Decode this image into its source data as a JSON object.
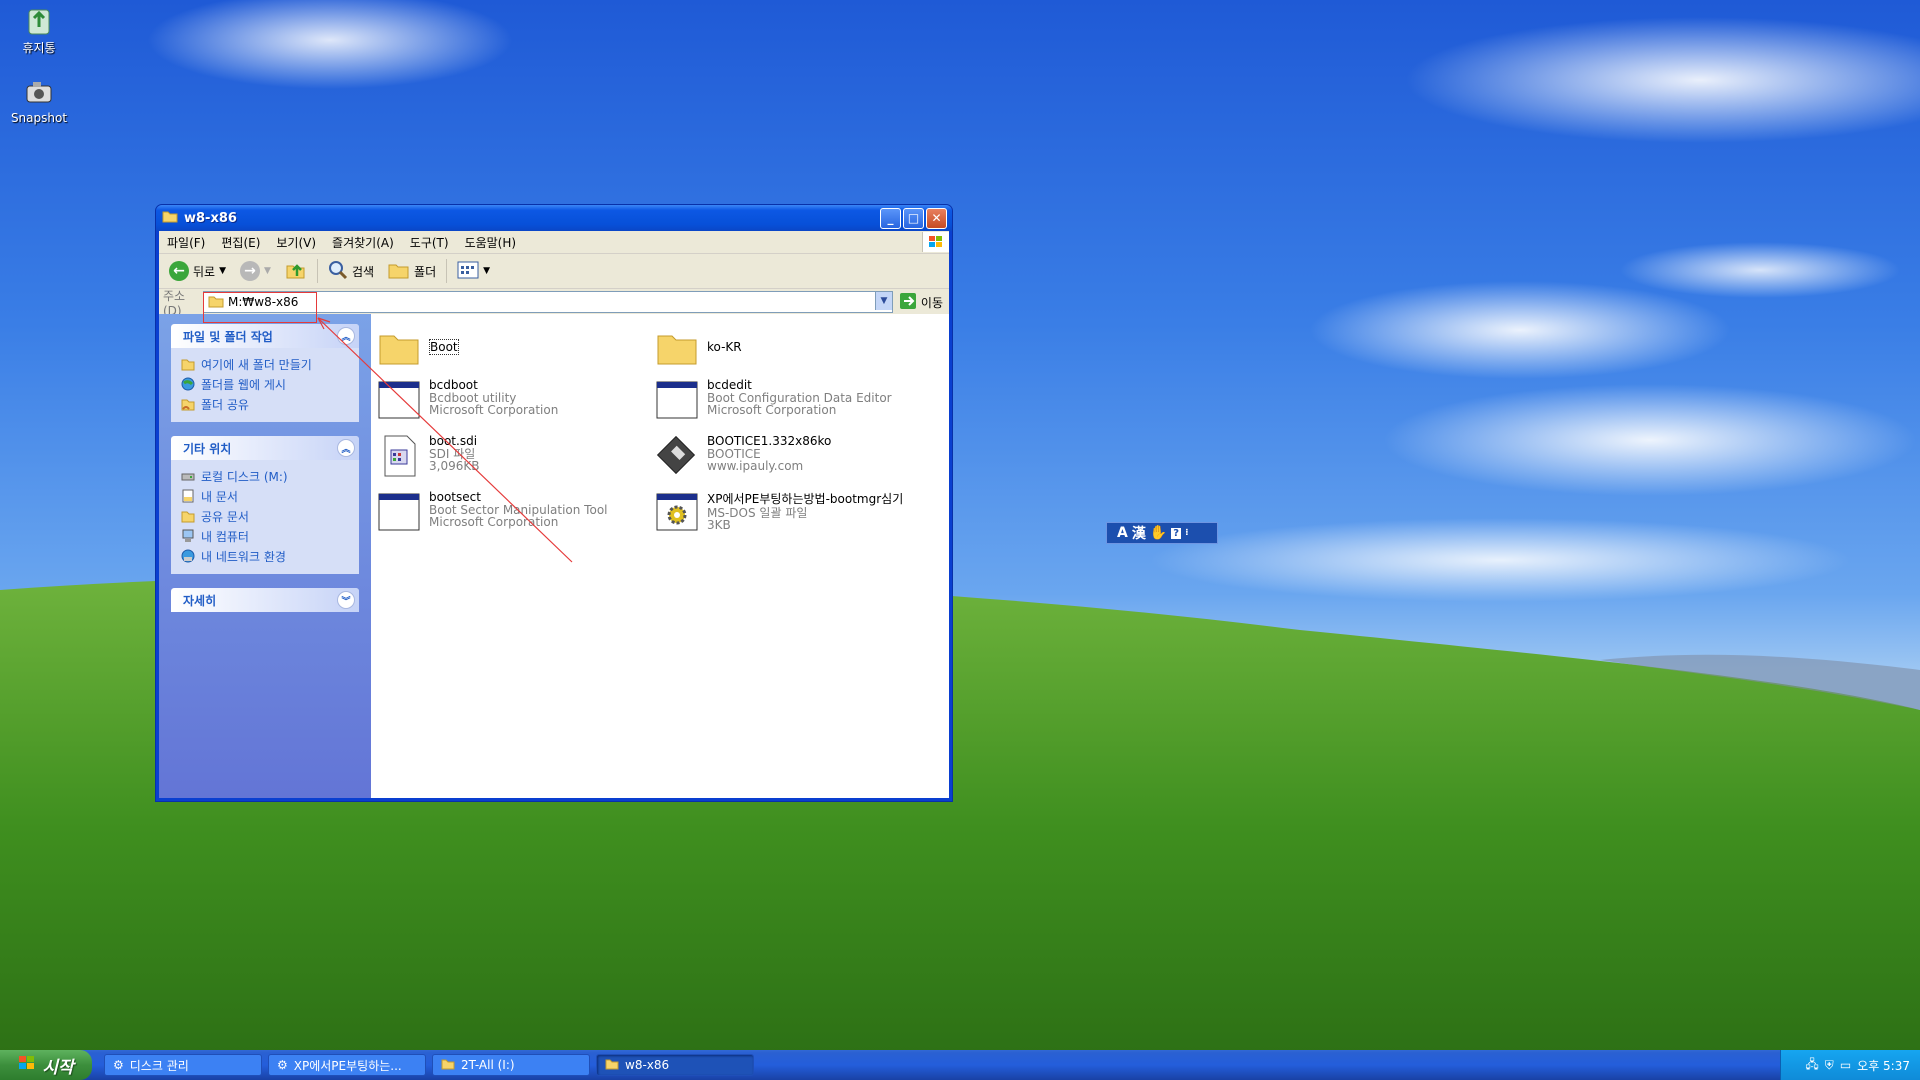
{
  "desktop": {
    "icons": [
      {
        "label": "휴지통",
        "icon": "recycle-bin-icon"
      },
      {
        "label": "Snapshot",
        "icon": "camera-icon"
      }
    ]
  },
  "window": {
    "title": "w8-x86",
    "menu": [
      "파일(F)",
      "편집(E)",
      "보기(V)",
      "즐겨찾기(A)",
      "도구(T)",
      "도움말(H)"
    ],
    "toolbar": {
      "back": "뒤로",
      "search": "검색",
      "folders": "폴더"
    },
    "address": {
      "label": "주소(D)",
      "value": "M:₩w8-x86",
      "go": "이동"
    },
    "tasks": {
      "file_folder_title": "파일 및 폴더 작업",
      "file_folder_items": [
        "여기에 새 폴더 만들기",
        "폴더를 웹에 게시",
        "폴더 공유"
      ],
      "other_places_title": "기타 위치",
      "other_places_items": [
        "로컬 디스크 (M:)",
        "내 문서",
        "공유 문서",
        "내 컴퓨터",
        "내 네트워크 환경"
      ],
      "details_title": "자세히"
    },
    "files": [
      {
        "name": "Boot",
        "type": "folder"
      },
      {
        "name": "ko-KR",
        "type": "folder"
      },
      {
        "name": "bcdboot",
        "line2": "Bcdboot utility",
        "line3": "Microsoft Corporation",
        "type": "app"
      },
      {
        "name": "bcdedit",
        "line2": "Boot Configuration Data Editor",
        "line3": "Microsoft Corporation",
        "type": "app"
      },
      {
        "name": "boot.sdi",
        "line2": "SDI 파일",
        "line3": "3,096KB",
        "type": "sdi"
      },
      {
        "name": "BOOTICE1.332x86ko",
        "line2": "BOOTICE",
        "line3": "www.ipauly.com",
        "type": "disk"
      },
      {
        "name": "bootsect",
        "line2": "Boot Sector Manipulation Tool",
        "line3": "Microsoft Corporation",
        "type": "app"
      },
      {
        "name": "XP에서PE부팅하는방법-bootmgr심기",
        "line2": "MS-DOS 일괄 파일",
        "line3": "3KB",
        "type": "batch"
      }
    ]
  },
  "ime": {
    "mode": "A",
    "hanja": "漢"
  },
  "taskbar": {
    "start": "시작",
    "tasks": [
      "디스크 관리",
      "XP에서PE부팅하는...",
      "2T-All (I:)",
      "w8-x86"
    ],
    "clock": "오후 5:37"
  },
  "colors": {
    "accent": "#0a3fd0",
    "link": "#215dc6",
    "annotation": "#e53a3a"
  }
}
